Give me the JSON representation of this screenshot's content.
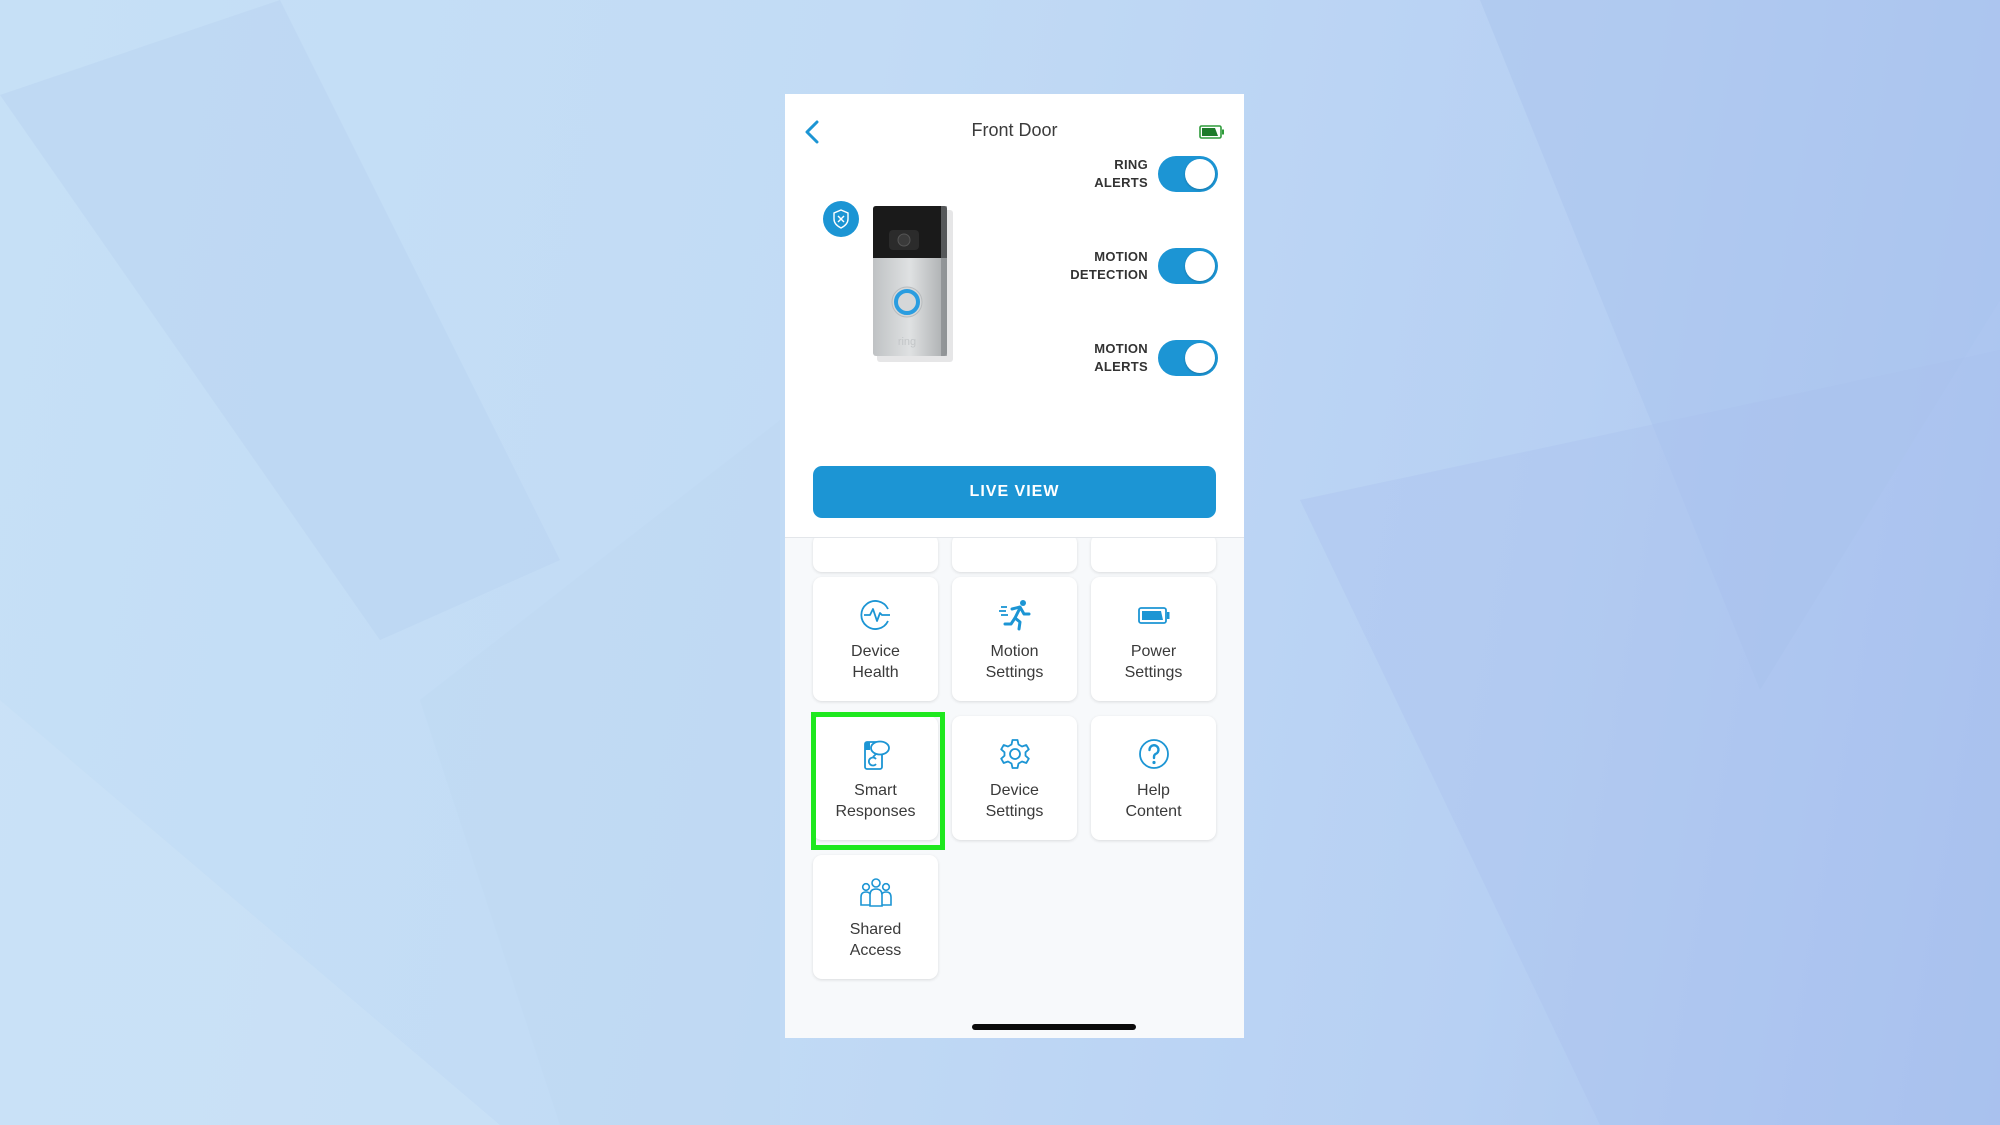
{
  "header": {
    "title": "Front Door",
    "back_icon": "chevron-left-icon",
    "battery_icon": "battery-icon"
  },
  "device": {
    "image": "ring-video-doorbell",
    "badge_icon": "shield-x-icon",
    "brand_text": "ring"
  },
  "toggles": [
    {
      "label_line1": "RING",
      "label_line2": "ALERTS",
      "on": true
    },
    {
      "label_line1": "MOTION",
      "label_line2": "DETECTION",
      "on": true
    },
    {
      "label_line1": "MOTION",
      "label_line2": "ALERTS",
      "on": true
    }
  ],
  "live_view_label": "LIVE VIEW",
  "tiles": [
    {
      "line1": "Device",
      "line2": "Health",
      "icon": "heartbeat-icon"
    },
    {
      "line1": "Motion",
      "line2": "Settings",
      "icon": "running-person-icon"
    },
    {
      "line1": "Power",
      "line2": "Settings",
      "icon": "battery-icon"
    },
    {
      "line1": "Smart",
      "line2": "Responses",
      "icon": "smart-responses-icon",
      "highlighted": true
    },
    {
      "line1": "Device",
      "line2": "Settings",
      "icon": "gear-icon"
    },
    {
      "line1": "Help",
      "line2": "Content",
      "icon": "question-circle-icon"
    },
    {
      "line1": "Shared",
      "line2": "Access",
      "icon": "users-icon"
    }
  ],
  "colors": {
    "accent": "#1c95d4",
    "highlight": "#1ee81e",
    "battery": "#2e9b3a"
  }
}
